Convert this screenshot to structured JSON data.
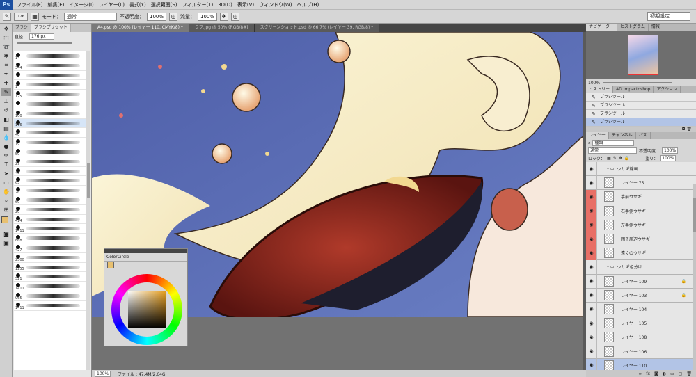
{
  "menu": {
    "logo": "Ps",
    "items": [
      "ファイル(F)",
      "編集(E)",
      "イメージ(I)",
      "レイヤー(L)",
      "書式(Y)",
      "選択範囲(S)",
      "フィルター(T)",
      "3D(D)",
      "表示(V)",
      "ウィンドウ(W)",
      "ヘルプ(H)"
    ]
  },
  "options": {
    "brush_size": "176",
    "mode_label": "モード：",
    "mode_value": "通常",
    "opacity_label": "不透明度：",
    "opacity_value": "100%",
    "flow_label": "流量：",
    "flow_value": "100%",
    "workspace": "初期設定"
  },
  "brush_panel": {
    "tabs": [
      "ブラシ",
      "ブラシプリセット"
    ],
    "size_label": "直径：",
    "size_value": "176 px",
    "brushes": [
      "14",
      "344",
      "",
      "1",
      "125",
      "",
      "100",
      "176",
      "40",
      "19",
      "50",
      "29",
      "40",
      "63",
      "26",
      "60",
      "20",
      "414",
      "1411",
      "868",
      "427",
      "2500",
      "1255",
      "521",
      "1411",
      "965",
      "1411"
    ]
  },
  "document_tabs": [
    "A4.psd @ 100% (レイヤー 110, CMYK/8) *",
    "ラフ.jpg @ 50% (RGB/8#)",
    "スクリーンショット.psd @ 66.7% (レイヤー 39, RGB/8) *"
  ],
  "status": {
    "zoom": "100%",
    "file": "ファイル : 47.4M/2.64G"
  },
  "colorcircle": {
    "title": "ColorCircle"
  },
  "navigator": {
    "tabs": [
      "ナビゲーター",
      "ヒストグラム",
      "情報"
    ],
    "zoom": "100%"
  },
  "history": {
    "tabs": [
      "ヒストリー",
      "AD Impactoshop",
      "アクション"
    ],
    "items": [
      "ブラシツール",
      "ブラシツール",
      "ブラシツール",
      "ブラシツール"
    ]
  },
  "layers": {
    "tabs": [
      "レイヤー",
      "チャンネル",
      "パス"
    ],
    "filter": "種類",
    "blend": "通常",
    "opacity_label": "不透明度：",
    "opacity": "100%",
    "lock_label": "ロック：",
    "fill_label": "塗り：",
    "fill": "100%",
    "rows": [
      {
        "name": "ウサギ線画",
        "group": true,
        "red": false,
        "locked": false,
        "selected": false
      },
      {
        "name": "レイヤー 75",
        "group": false,
        "red": false,
        "locked": false,
        "selected": false
      },
      {
        "name": "手前ウサギ",
        "group": false,
        "red": true,
        "locked": false,
        "selected": false
      },
      {
        "name": "右手側ウサギ",
        "group": false,
        "red": true,
        "locked": false,
        "selected": false
      },
      {
        "name": "左手側ウサギ",
        "group": false,
        "red": true,
        "locked": false,
        "selected": false
      },
      {
        "name": "団子周辺ウサギ",
        "group": false,
        "red": true,
        "locked": false,
        "selected": false
      },
      {
        "name": "遠くのウサギ",
        "group": false,
        "red": true,
        "locked": false,
        "selected": false
      },
      {
        "name": "ウサギ色分け",
        "group": true,
        "red": false,
        "locked": false,
        "selected": false
      },
      {
        "name": "レイヤー 109",
        "group": false,
        "red": false,
        "locked": true,
        "selected": false
      },
      {
        "name": "レイヤー 103",
        "group": false,
        "red": false,
        "locked": true,
        "selected": false
      },
      {
        "name": "レイヤー 104",
        "group": false,
        "red": false,
        "locked": false,
        "selected": false
      },
      {
        "name": "レイヤー 105",
        "group": false,
        "red": false,
        "locked": false,
        "selected": false
      },
      {
        "name": "レイヤー 108",
        "group": false,
        "red": false,
        "locked": false,
        "selected": false
      },
      {
        "name": "レイヤー 106",
        "group": false,
        "red": false,
        "locked": false,
        "selected": false
      },
      {
        "name": "レイヤー 110",
        "group": false,
        "red": false,
        "locked": false,
        "selected": true
      }
    ]
  },
  "colors": {
    "fg": "#e8c070",
    "bg": "#ffffff",
    "accent_red": "#e86f66",
    "canvas_blue": "#5b6fb8"
  }
}
